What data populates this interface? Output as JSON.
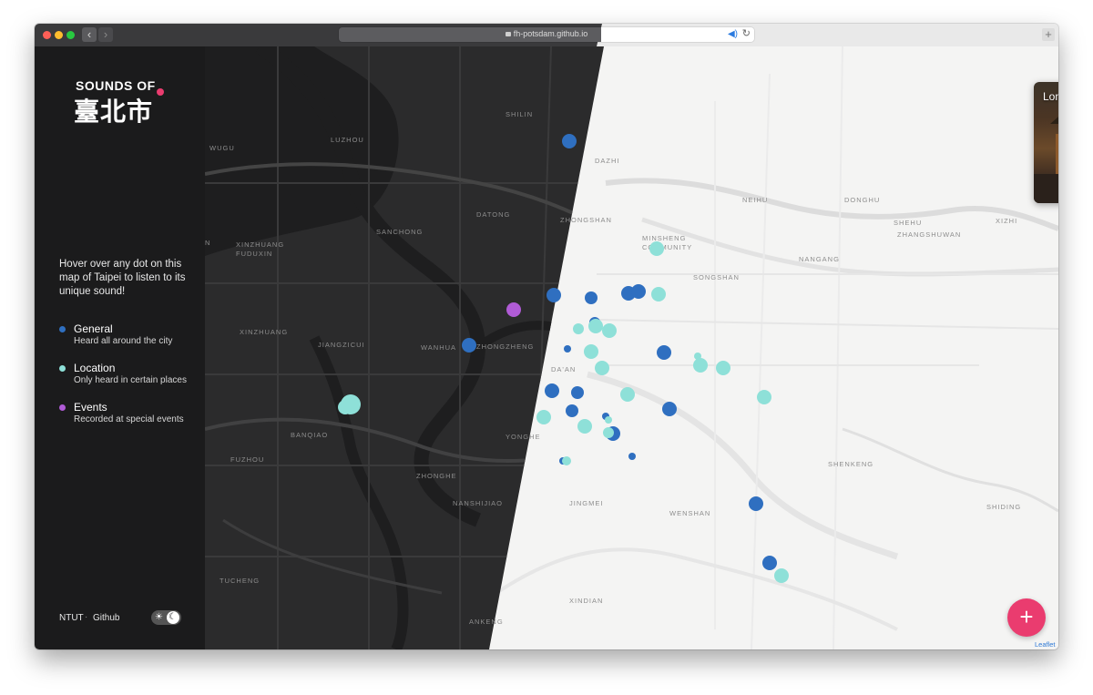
{
  "browser": {
    "url": "fh-potsdam.github.io"
  },
  "sidebar": {
    "logo_top": "SOUNDS OF",
    "logo_cn": "臺北市",
    "intro": "Hover over any dot on this map of Taipei to listen to its unique sound!",
    "legend": [
      {
        "title": "General",
        "desc": "Heard all around the city",
        "color": "#2f6fc0"
      },
      {
        "title": "Location",
        "desc": "Only heard in certain places",
        "color": "#8ee0d8"
      },
      {
        "title": "Events",
        "desc": "Recorded at special events",
        "color": "#b05bd6"
      }
    ],
    "footer": {
      "link1": "NTUT",
      "sep": "·",
      "link2": "Github"
    },
    "toggle": {
      "sun": "☀",
      "moon": "☾"
    }
  },
  "map": {
    "labels": [
      "SHILIN",
      "WUGU",
      "LUZHOU",
      "DAZHI",
      "DATONG",
      "ZHONGSHAN",
      "SANCHONG",
      "XINZHUANG FUDUXIN",
      "MINSHENG COMMUNITY",
      "NEIHU",
      "DONGHU",
      "SHEHU",
      "XIZHI",
      "ZHANGSHUWAN",
      "NANGANG",
      "SONGSHAN",
      "XINZHUANG",
      "JIANGZICUI",
      "WANHUA",
      "ZHONGZHENG",
      "DA'AN",
      "BANQIAO",
      "FUZHOU",
      "ZHONGHE",
      "YONGHE",
      "SHENKENG",
      "SHIDING",
      "JINGMEI",
      "WENSHAN",
      "NANSHIJIAO",
      "XINDIAN",
      "TUCHENG",
      "ANKENG",
      "N"
    ],
    "colors": {
      "dark_bg": "#2b2b2c",
      "light_bg": "#f4f4f3",
      "general": "#2f6fc0",
      "location": "#8ee0d8",
      "events": "#b05bd6"
    },
    "dot_counts": {
      "general": 19,
      "location": 20,
      "events": 1
    }
  },
  "popup": {
    "title": "Longshan Temple"
  },
  "fab": {
    "label": "+"
  },
  "attribution": "Leaflet"
}
